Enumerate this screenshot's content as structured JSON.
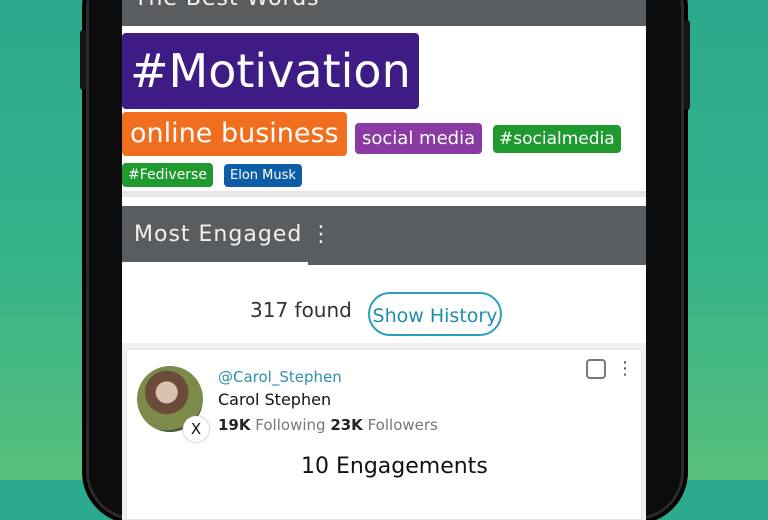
{
  "best_words": {
    "title": "The Best Words",
    "tags": [
      "#Motivation",
      "online business",
      "social media",
      "#socialmedia",
      "#Fediverse",
      "Elon Musk"
    ]
  },
  "most_engaged": {
    "title": "Most Engaged",
    "menu_icon": "⋮",
    "found_text": "317 found",
    "show_history_label": "Show History"
  },
  "card": {
    "handle": "@Carol_Stephen",
    "name": "Carol Stephen",
    "following_count": "19K",
    "following_label": "Following",
    "followers_count": "23K",
    "followers_label": "Followers",
    "engagements": "10 Engagements",
    "x_badge": "X",
    "menu_icon": "⋮"
  }
}
